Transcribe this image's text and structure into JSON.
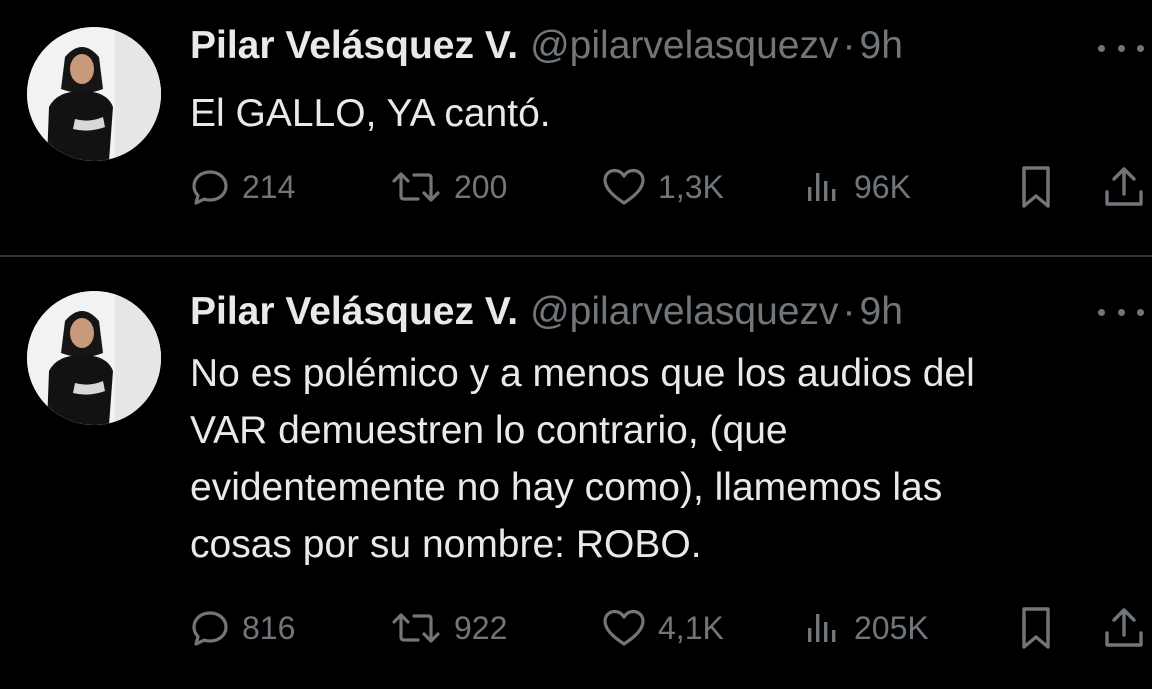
{
  "tweets": [
    {
      "author_name": "Pilar Velásquez V.",
      "handle": "@pilarvelasquezv",
      "separator": "·",
      "time": "9h",
      "text": "El GALLO, YA cantó.",
      "replies": "214",
      "reposts": "200",
      "likes": "1,3K",
      "views": "96K"
    },
    {
      "author_name": "Pilar Velásquez V.",
      "handle": "@pilarvelasquezv",
      "separator": "·",
      "time": "9h",
      "text": "No es polémico y a menos que los audios del\nVAR demuestren lo contrario, (que\nevidentemente no hay como), llamemos las\ncosas por su nombre: ROBO.",
      "replies": "816",
      "reposts": "922",
      "likes": "4,1K",
      "views": "205K"
    }
  ],
  "icons": {
    "reply": "reply-icon",
    "repost": "repost-icon",
    "like": "heart-icon",
    "views": "views-icon",
    "bookmark": "bookmark-icon",
    "share": "share-icon",
    "more": "more-icon"
  },
  "colors": {
    "background": "#000000",
    "primary_text": "#e7e9ea",
    "secondary_text": "#71767b",
    "divider": "#2f3336"
  }
}
